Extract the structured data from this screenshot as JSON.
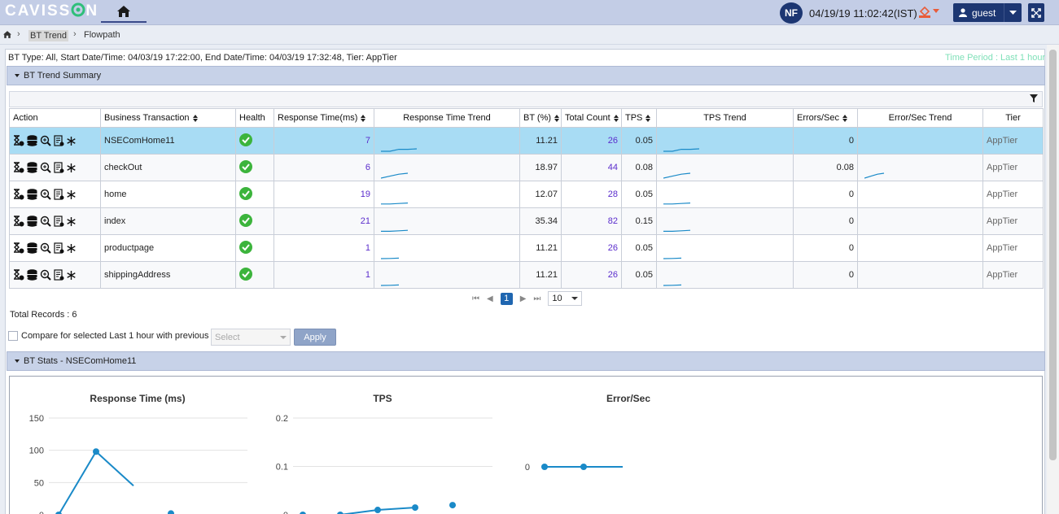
{
  "header": {
    "logo": "CAVISSON",
    "user_initials": "NF",
    "datetime": "04/19/19 11:02:42(IST)",
    "user_name": "guest"
  },
  "breadcrumb": [
    "BT Trend",
    "Flowpath"
  ],
  "info": {
    "line": "BT Type: All, Start Date/Time: 04/03/19 17:22:00, End Date/Time: 04/03/19 17:32:48, Tier: AppTier",
    "time_period": "Time Period : Last 1 hour"
  },
  "summary": {
    "title": "BT Trend Summary",
    "columns": [
      "Action",
      "Business Transaction",
      "Health",
      "Response Time(ms)",
      "Response Time Trend",
      "BT (%)",
      "Total Count",
      "TPS",
      "TPS Trend",
      "Errors/Sec",
      "Error/Sec Trend",
      "Tier"
    ],
    "rows": [
      {
        "bt": "NSEComHome11",
        "rt": "7",
        "btp": "11.21",
        "count": "26",
        "tps": "0.05",
        "err": "0",
        "tier": "AppTier",
        "rt_trend": [
          0,
          0,
          0.2,
          0.2,
          0.25
        ],
        "tps_trend": [
          0,
          0,
          0.2,
          0.2,
          0.25
        ],
        "err_trend": []
      },
      {
        "bt": "checkOut",
        "rt": "6",
        "btp": "18.97",
        "count": "44",
        "tps": "0.08",
        "err": "0.08",
        "tier": "AppTier",
        "rt_trend": [
          0,
          0.2,
          0.4,
          0.5
        ],
        "tps_trend": [
          0,
          0.2,
          0.4,
          0.5
        ],
        "err_trend": [
          0,
          0.2,
          0.4,
          0.5
        ]
      },
      {
        "bt": "home",
        "rt": "19",
        "btp": "12.07",
        "count": "28",
        "tps": "0.05",
        "err": "0",
        "tier": "AppTier",
        "rt_trend": [
          0.1,
          0.1,
          0.15,
          0.2
        ],
        "tps_trend": [
          0.1,
          0.1,
          0.15,
          0.2
        ],
        "err_trend": []
      },
      {
        "bt": "index",
        "rt": "21",
        "btp": "35.34",
        "count": "82",
        "tps": "0.15",
        "err": "0",
        "tier": "AppTier",
        "rt_trend": [
          0.05,
          0.05,
          0.1,
          0.15
        ],
        "tps_trend": [
          0.05,
          0.05,
          0.1,
          0.15
        ],
        "err_trend": []
      },
      {
        "bt": "productpage",
        "rt": "1",
        "btp": "11.21",
        "count": "26",
        "tps": "0.05",
        "err": "0",
        "tier": "AppTier",
        "rt_trend": [
          0,
          0.02,
          0.05
        ],
        "tps_trend": [
          0,
          0.02,
          0.05
        ],
        "err_trend": []
      },
      {
        "bt": "shippingAddress",
        "rt": "1",
        "btp": "11.21",
        "count": "26",
        "tps": "0.05",
        "err": "0",
        "tier": "AppTier",
        "rt_trend": [
          0,
          0.02,
          0.05
        ],
        "tps_trend": [
          0,
          0.02,
          0.05
        ],
        "err_trend": []
      }
    ]
  },
  "pagination": {
    "page": "1",
    "rows_per_page": "10"
  },
  "total_records": "Total Records : 6",
  "compare": {
    "label": "Compare for selected Last 1 hour with previous",
    "placeholder": "Select",
    "apply": "Apply"
  },
  "stats": {
    "title": "BT Stats - NSEComHome11"
  },
  "colors": {
    "accent": "#1f66b0",
    "line": "#1a8ac8",
    "selected_row": "#a8dcf4",
    "health": "#3cb43c"
  },
  "chart_data": [
    {
      "type": "line",
      "title": "Response Time (ms)",
      "ylim": [
        0,
        150
      ],
      "yticks": [
        0,
        50,
        100,
        150
      ],
      "series": [
        {
          "values": [
            [
              1,
              0
            ],
            [
              2,
              98
            ],
            [
              3,
              45
            ]
          ]
        },
        {
          "values": [
            [
              4,
              2
            ]
          ]
        }
      ]
    },
    {
      "type": "line",
      "title": "TPS",
      "ylim": [
        0,
        0.2
      ],
      "yticks": [
        0,
        0.1,
        0.2
      ],
      "series": [
        {
          "values": [
            [
              1,
              0
            ],
            [
              2,
              0
            ],
            [
              3,
              0.01
            ],
            [
              4,
              0.015
            ]
          ]
        },
        {
          "values": [
            [
              5,
              0.02
            ]
          ]
        }
      ]
    },
    {
      "type": "line",
      "title": "Error/Sec",
      "ylim": [
        0,
        0
      ],
      "yticks": [
        0
      ],
      "series": [
        {
          "values": [
            [
              1,
              0
            ],
            [
              2,
              0
            ],
            [
              3,
              0
            ]
          ]
        }
      ]
    }
  ]
}
